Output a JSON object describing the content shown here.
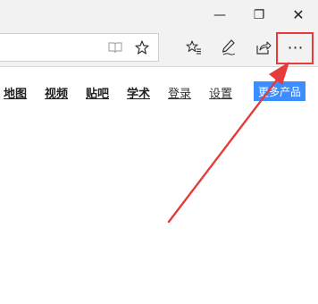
{
  "window_controls": {
    "minimize_glyph": "—",
    "restore_glyph": "❐",
    "close_glyph": "✕"
  },
  "toolbar": {
    "reading_view_icon": "reading-view-icon",
    "favorite_icon": "star-icon",
    "favorites_hub_icon": "favorites-list-icon",
    "notes_icon": "pen-icon",
    "share_icon": "share-icon",
    "more_glyph": "⋯"
  },
  "nav": {
    "links": [
      "地图",
      "视频",
      "贴吧",
      "学术",
      "登录",
      "设置"
    ],
    "more_products": "更多产品"
  },
  "colors": {
    "annotation_red": "#e53b3b",
    "button_blue": "#3c8dff"
  }
}
